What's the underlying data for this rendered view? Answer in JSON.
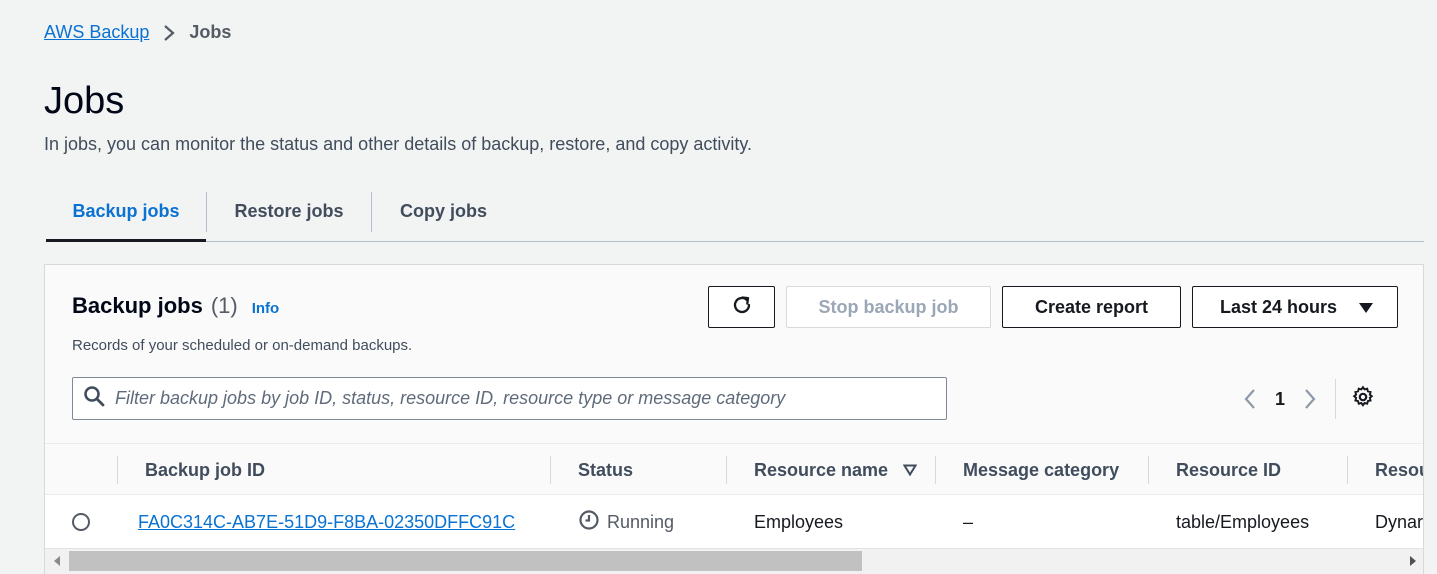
{
  "breadcrumb": {
    "root": "AWS Backup",
    "current": "Jobs"
  },
  "page": {
    "title": "Jobs",
    "description": "In jobs, you can monitor the status and other details of backup, restore, and copy activity."
  },
  "tabs": [
    {
      "label": "Backup jobs",
      "active": true
    },
    {
      "label": "Restore jobs",
      "active": false
    },
    {
      "label": "Copy jobs",
      "active": false
    }
  ],
  "panel": {
    "title": "Backup jobs",
    "count": "(1)",
    "info": "Info",
    "description": "Records of your scheduled or on-demand backups.",
    "buttons": {
      "refresh_icon": "refresh-icon",
      "stop": "Stop backup job",
      "report": "Create report",
      "range": "Last 24 hours"
    },
    "search": {
      "placeholder": "Filter backup jobs by job ID, status, resource ID, resource type or message category",
      "value": ""
    },
    "pagination": {
      "current_page": "1"
    }
  },
  "table": {
    "columns": [
      "Backup job ID",
      "Status",
      "Resource name",
      "Message category",
      "Resource ID",
      "Resou"
    ],
    "rows": [
      {
        "job_id": "FA0C314C-AB7E-51D9-F8BA-02350DFFC91C",
        "status": "Running",
        "resource_name": "Employees",
        "message_category": "–",
        "resource_id": "table/Employees",
        "resource_type": "Dynar"
      }
    ]
  },
  "colors": {
    "link": "#0972d3",
    "background": "#f2f3f3",
    "border": "#d5dbdb",
    "text": "#16191f"
  }
}
